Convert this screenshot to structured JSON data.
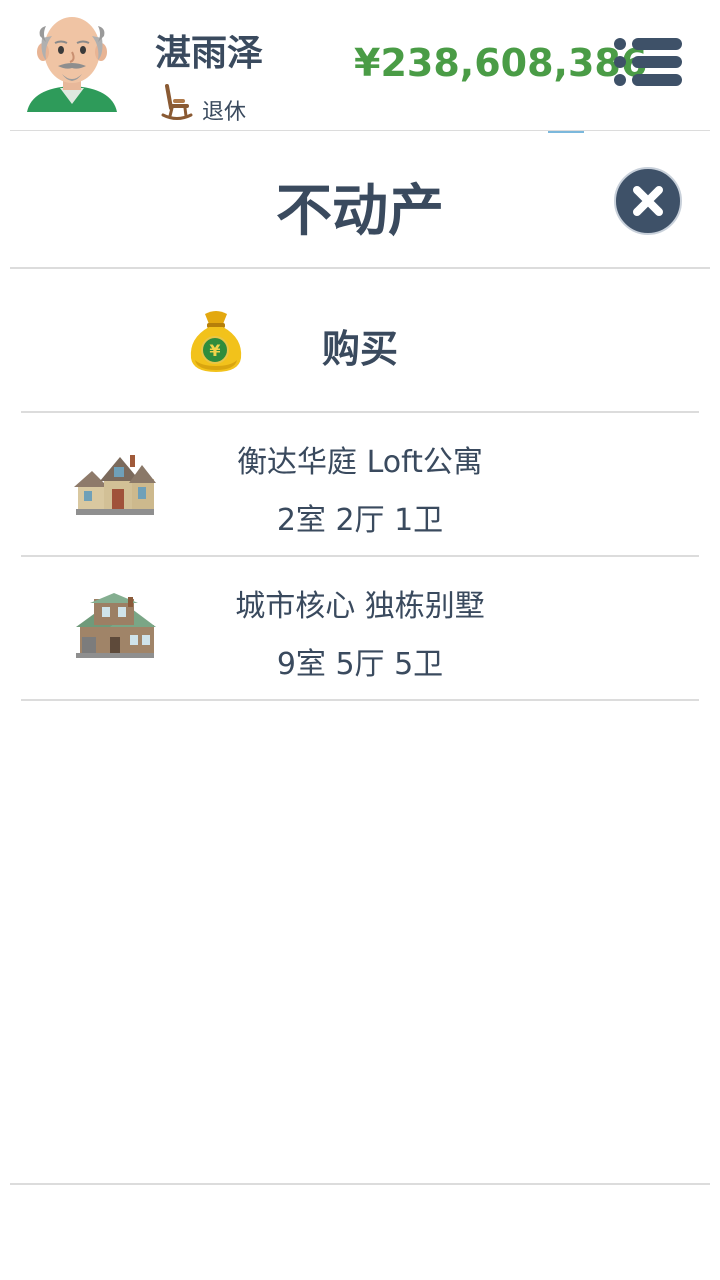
{
  "header": {
    "player_name": "湛雨泽",
    "status": "退休",
    "money": "¥238,608,386"
  },
  "page": {
    "title": "不动产"
  },
  "buy": {
    "label": "购买"
  },
  "properties": [
    {
      "name": "衡达华庭 Loft公寓",
      "rooms": "2室 2厅 1卫"
    },
    {
      "name": "城市核心 独栋别墅",
      "rooms": "9室 5厅 5卫"
    }
  ],
  "colors": {
    "text": "#3a4a5e",
    "money": "#4a9c46",
    "close_button": "#3e5168",
    "divider": "#dcdcdc"
  },
  "icons": {
    "avatar": "old-man-avatar",
    "status": "rocking-chair-icon",
    "menu": "list-menu-icon",
    "close": "close-icon",
    "buy": "money-bag-icon",
    "property_1": "house-icon",
    "property_2": "villa-icon"
  }
}
